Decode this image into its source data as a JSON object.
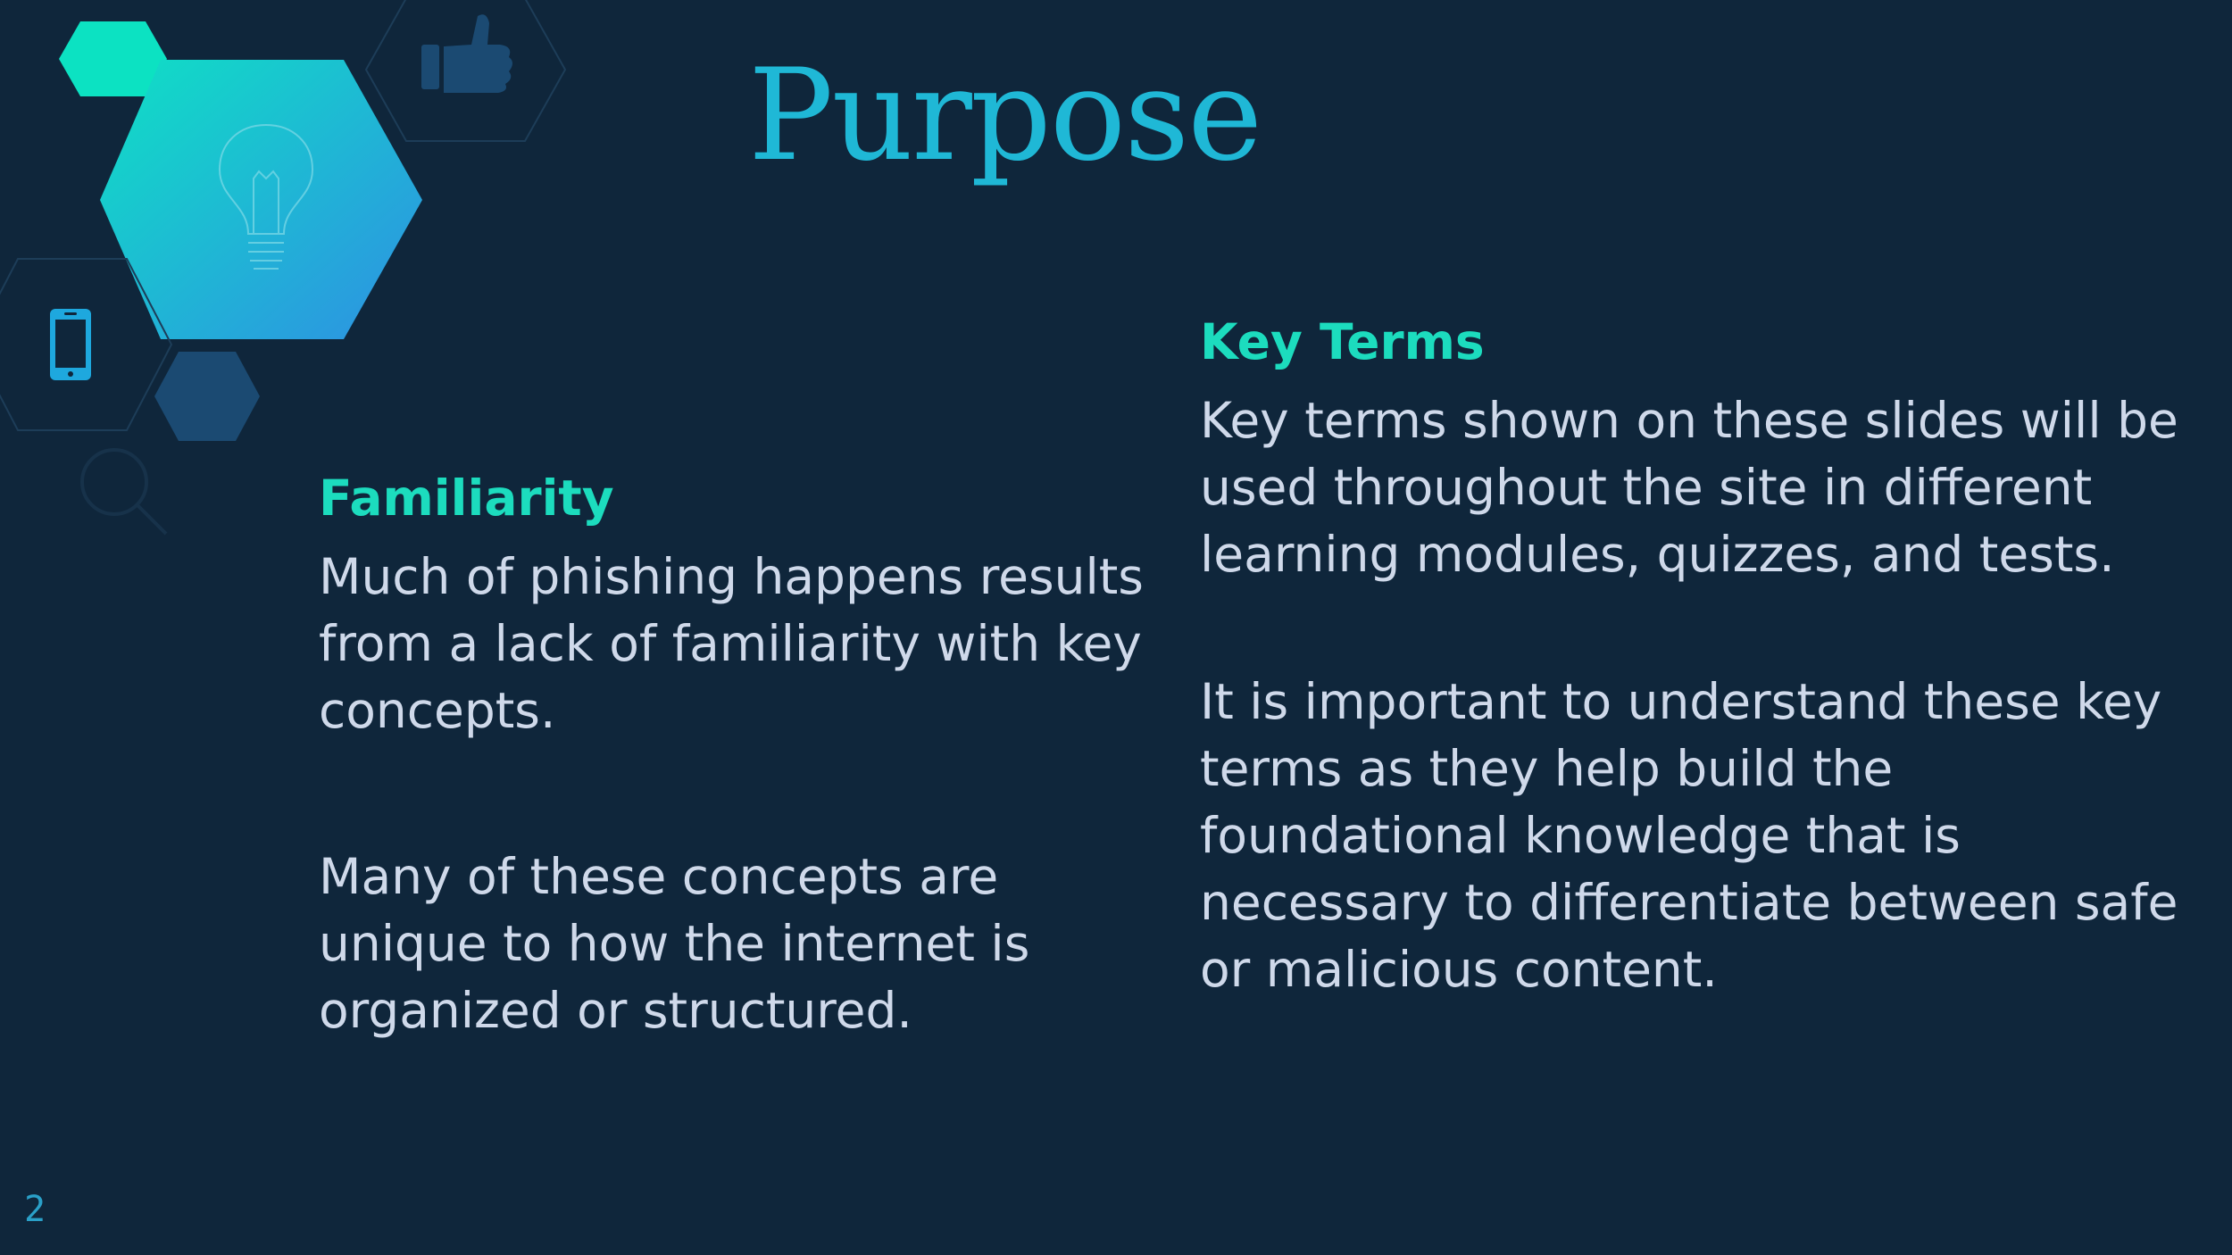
{
  "slide": {
    "title": "Purpose",
    "page_number": "2"
  },
  "left_column": {
    "heading": "Familiarity",
    "paragraphs": [
      "Much of phishing happens results from a lack of familiarity with key concepts.",
      "Many of these concepts are unique to how the internet is organized or structured."
    ]
  },
  "right_column": {
    "heading": "Key Terms",
    "paragraphs": [
      "Key terms shown on these slides will be used throughout the site in different learning modules, quizzes, and tests.",
      "It is important to understand these key terms as they help build the foundational knowledge that is necessary to differentiate between safe or malicious content."
    ]
  },
  "decoration": {
    "icons": [
      "lightbulb-icon",
      "thumbs-up-icon",
      "smartphone-icon",
      "magnifier-icon"
    ],
    "colors": {
      "background": "#0f263b",
      "title": "#1fb8d6",
      "heading": "#1cdcbe",
      "body_text": "#cfd9ea",
      "hex_gradient_start": "#0fe0c5",
      "hex_gradient_end": "#2e90e3",
      "hex_dark": "#1b4a72"
    }
  }
}
